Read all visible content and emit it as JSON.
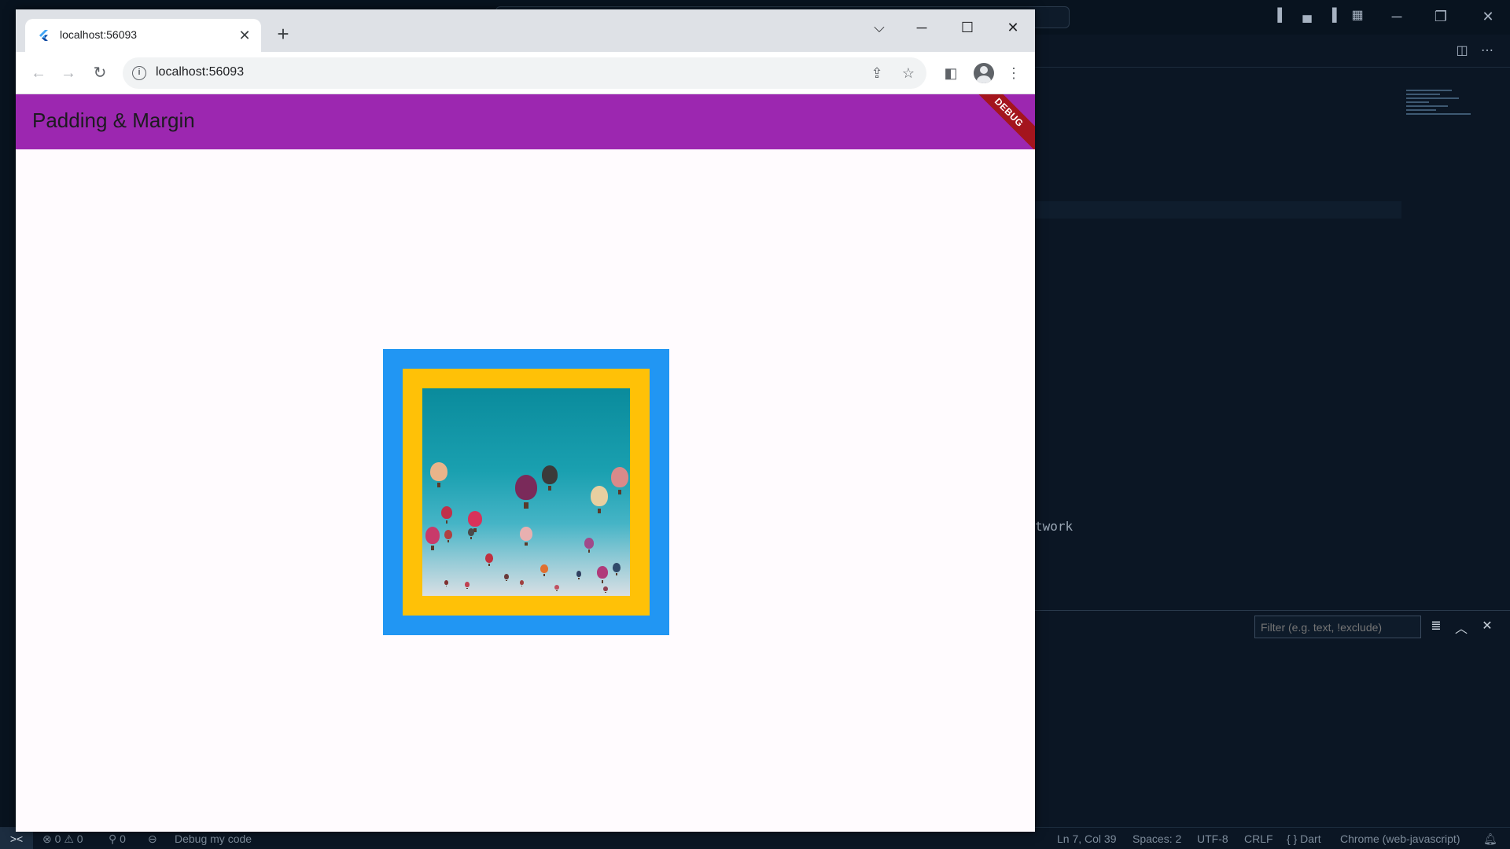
{
  "browser": {
    "tab_title": "localhost:56093",
    "url": "localhost:56093"
  },
  "app": {
    "title": "Padding & Margin",
    "debug_banner": "DEBUG",
    "colors": {
      "appbar": "#9c27b0",
      "margin_box": "#2196f3",
      "padding_box": "#ffc107",
      "background": "#fffbfe"
    }
  },
  "vscode": {
    "code_fragment": "twork",
    "filter_placeholder": "Filter (e.g. text, !exclude)",
    "status": {
      "errors": "0",
      "warnings": "0",
      "ports": "0",
      "debug_label": "Debug my code",
      "cursor": "Ln 7, Col 39",
      "spaces": "Spaces: 2",
      "encoding": "UTF-8",
      "eol": "CRLF",
      "language": "Dart",
      "device": "Chrome (web-javascript)"
    }
  }
}
